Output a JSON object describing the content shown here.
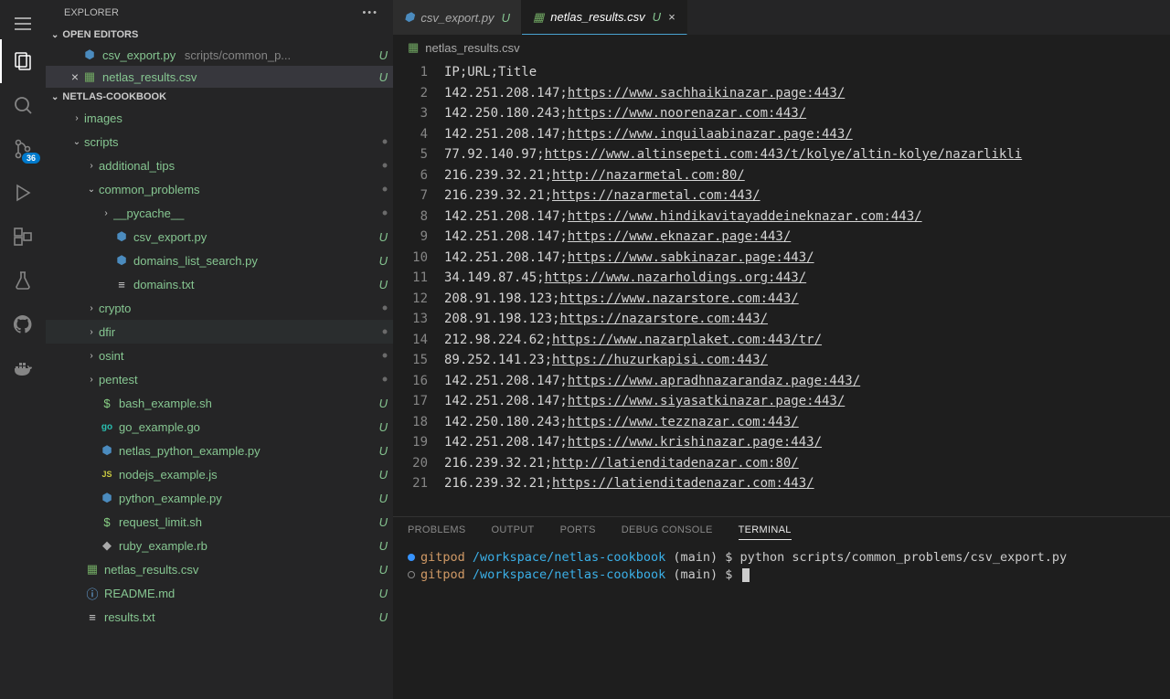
{
  "activity_bar": {
    "badge": "36"
  },
  "sidebar": {
    "title": "EXPLORER",
    "sections": {
      "open_editors": "OPEN EDITORS",
      "project": "NETLAS-COOKBOOK"
    },
    "open_editors": [
      {
        "icon": "py",
        "name": "csv_export.py",
        "path": "scripts/common_p...",
        "status": "U"
      },
      {
        "icon": "csv",
        "name": "netlas_results.csv",
        "path": "",
        "status": "U",
        "active": true
      }
    ],
    "tree": [
      {
        "depth": 1,
        "kind": "folder",
        "open": false,
        "name": "images"
      },
      {
        "depth": 1,
        "kind": "folder",
        "open": true,
        "name": "scripts",
        "status": "dot"
      },
      {
        "depth": 2,
        "kind": "folder",
        "open": false,
        "name": "additional_tips",
        "status": "dot"
      },
      {
        "depth": 2,
        "kind": "folder",
        "open": true,
        "name": "common_problems",
        "status": "dot"
      },
      {
        "depth": 3,
        "kind": "folder",
        "open": false,
        "name": "__pycache__",
        "status": "dot"
      },
      {
        "depth": 3,
        "kind": "file",
        "icon": "py",
        "name": "csv_export.py",
        "status": "U"
      },
      {
        "depth": 3,
        "kind": "file",
        "icon": "py",
        "name": "domains_list_search.py",
        "status": "U"
      },
      {
        "depth": 3,
        "kind": "file",
        "icon": "txt",
        "name": "domains.txt",
        "status": "U"
      },
      {
        "depth": 2,
        "kind": "folder",
        "open": false,
        "name": "crypto",
        "status": "dot"
      },
      {
        "depth": 2,
        "kind": "folder",
        "open": false,
        "name": "dfir",
        "status": "dot",
        "hover": true
      },
      {
        "depth": 2,
        "kind": "folder",
        "open": false,
        "name": "osint",
        "status": "dot"
      },
      {
        "depth": 2,
        "kind": "folder",
        "open": false,
        "name": "pentest",
        "status": "dot"
      },
      {
        "depth": 2,
        "kind": "file",
        "icon": "sh",
        "name": "bash_example.sh",
        "status": "U"
      },
      {
        "depth": 2,
        "kind": "file",
        "icon": "go",
        "name": "go_example.go",
        "status": "U"
      },
      {
        "depth": 2,
        "kind": "file",
        "icon": "py",
        "name": "netlas_python_example.py",
        "status": "U"
      },
      {
        "depth": 2,
        "kind": "file",
        "icon": "js",
        "name": "nodejs_example.js",
        "status": "U"
      },
      {
        "depth": 2,
        "kind": "file",
        "icon": "py",
        "name": "python_example.py",
        "status": "U"
      },
      {
        "depth": 2,
        "kind": "file",
        "icon": "sh",
        "name": "request_limit.sh",
        "status": "U"
      },
      {
        "depth": 2,
        "kind": "file",
        "icon": "rb",
        "name": "ruby_example.rb",
        "status": "U"
      },
      {
        "depth": 1,
        "kind": "file",
        "icon": "csv",
        "name": "netlas_results.csv",
        "status": "U"
      },
      {
        "depth": 1,
        "kind": "file",
        "icon": "info",
        "name": "README.md",
        "status": "U"
      },
      {
        "depth": 1,
        "kind": "file",
        "icon": "txt",
        "name": "results.txt",
        "status": "U"
      }
    ]
  },
  "tabs": [
    {
      "icon": "py",
      "name": "csv_export.py",
      "status": "U"
    },
    {
      "icon": "csv",
      "name": "netlas_results.csv",
      "status": "U",
      "active": true,
      "closable": true
    }
  ],
  "breadcrumb": {
    "icon": "csv",
    "name": "netlas_results.csv"
  },
  "editor": {
    "lines": [
      {
        "text": "IP;URL;Title"
      },
      {
        "ip": "142.251.208.147",
        "url": "https://www.sachhaikinazar.page:443/"
      },
      {
        "ip": "142.250.180.243",
        "url": "https://www.noorenazar.com:443/"
      },
      {
        "ip": "142.251.208.147",
        "url": "https://www.inquilaabinazar.page:443/"
      },
      {
        "ip": "77.92.140.97",
        "url": "https://www.altinsepeti.com:443/t/kolye/altin-kolye/nazarlikli"
      },
      {
        "ip": "216.239.32.21",
        "url": "http://nazarmetal.com:80/"
      },
      {
        "ip": "216.239.32.21",
        "url": "https://nazarmetal.com:443/"
      },
      {
        "ip": "142.251.208.147",
        "url": "https://www.hindikavitayaddeineknazar.com:443/"
      },
      {
        "ip": "142.251.208.147",
        "url": "https://www.eknazar.page:443/"
      },
      {
        "ip": "142.251.208.147",
        "url": "https://www.sabkinazar.page:443/"
      },
      {
        "ip": "34.149.87.45",
        "url": "https://www.nazarholdings.org:443/"
      },
      {
        "ip": "208.91.198.123",
        "url": "https://www.nazarstore.com:443/"
      },
      {
        "ip": "208.91.198.123",
        "url": "https://nazarstore.com:443/"
      },
      {
        "ip": "212.98.224.62",
        "url": "https://www.nazarplaket.com:443/tr/"
      },
      {
        "ip": "89.252.141.23",
        "url": "https://huzurkapisi.com:443/"
      },
      {
        "ip": "142.251.208.147",
        "url": "https://www.apradhnazarandaz.page:443/"
      },
      {
        "ip": "142.251.208.147",
        "url": "https://www.siyasatkinazar.page:443/"
      },
      {
        "ip": "142.250.180.243",
        "url": "https://www.tezznazar.com:443/"
      },
      {
        "ip": "142.251.208.147",
        "url": "https://www.krishinazar.page:443/"
      },
      {
        "ip": "216.239.32.21",
        "url": "http://latienditadenazar.com:80/"
      },
      {
        "ip": "216.239.32.21",
        "url": "https://latienditadenazar.com:443/"
      }
    ]
  },
  "panel": {
    "tabs": [
      "PROBLEMS",
      "OUTPUT",
      "PORTS",
      "DEBUG CONSOLE",
      "TERMINAL"
    ],
    "active": "TERMINAL",
    "terminal": {
      "prompt_user": "gitpod",
      "prompt_path": "/workspace/netlas-cookbook",
      "prompt_branch": "(main)",
      "prompt_symbol": "$",
      "lines": [
        {
          "dot": "blue",
          "cmd": "python scripts/common_problems/csv_export.py"
        },
        {
          "dot": "empty",
          "cmd": "",
          "cursor": true
        }
      ]
    }
  }
}
